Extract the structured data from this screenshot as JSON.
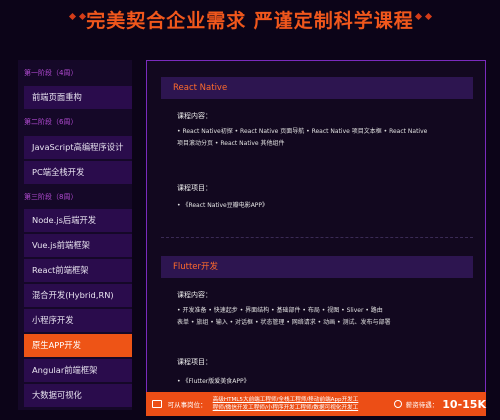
{
  "page_title": "完美契合企业需求 严谨定制科学课程",
  "sidebar": {
    "stage1": {
      "header": "第一阶段（4周）",
      "items": [
        "前端页面重构"
      ]
    },
    "stage2": {
      "header": "第二阶段（6周）",
      "items": [
        "JavaScript高编程序设计",
        "PC端全栈开发"
      ]
    },
    "stage3": {
      "header": "第三阶段（8周）",
      "items": [
        "Node.js后端开发",
        "Vue.js前端框架",
        "React前端框架",
        "混合开发(Hybrid,RN)",
        "小程序开发",
        "原生APP开发",
        "Angular前端框架",
        "大数据可视化"
      ]
    },
    "active_item": "原生APP开发"
  },
  "main": {
    "react_native": {
      "title": "React Native",
      "content_label": "课程内容：",
      "content_line1": "• React Native初探   • React Native 页面导航   • React Native 项目文本框   • React Native",
      "content_line2": "项目滚动分页   • React Native 其他组件",
      "project_label": "课程项目：",
      "project_item": "• 《React Native豆瓣电影APP》"
    },
    "flutter": {
      "title": "Flutter开发",
      "content_label": "课程内容：",
      "content_line1": "• 开发准备   • 快速起步   • 界面结构   • 基础部件   • 布局   • 视图   • Sliver   • 路由",
      "content_line2": "表单   • 旅组   • 输入   • 对话框   • 状态管理   • 网络请求   • 动画   • 测试、发布与部署",
      "project_label": "课程项目：",
      "project_item": "• 《Flutter版爱美食APP》"
    }
  },
  "banner": {
    "label": "可从事岗位：",
    "positions_line1": "高级HTML5大前端工程师/全栈工程师/移动前端App开发工",
    "positions_line2": "程师/微信开发工程师/小程序开发工程师/数据可视化开发工",
    "salary_label": "薪资待遇：",
    "salary": "10-15K",
    "accent_color": "#ec4e16"
  }
}
